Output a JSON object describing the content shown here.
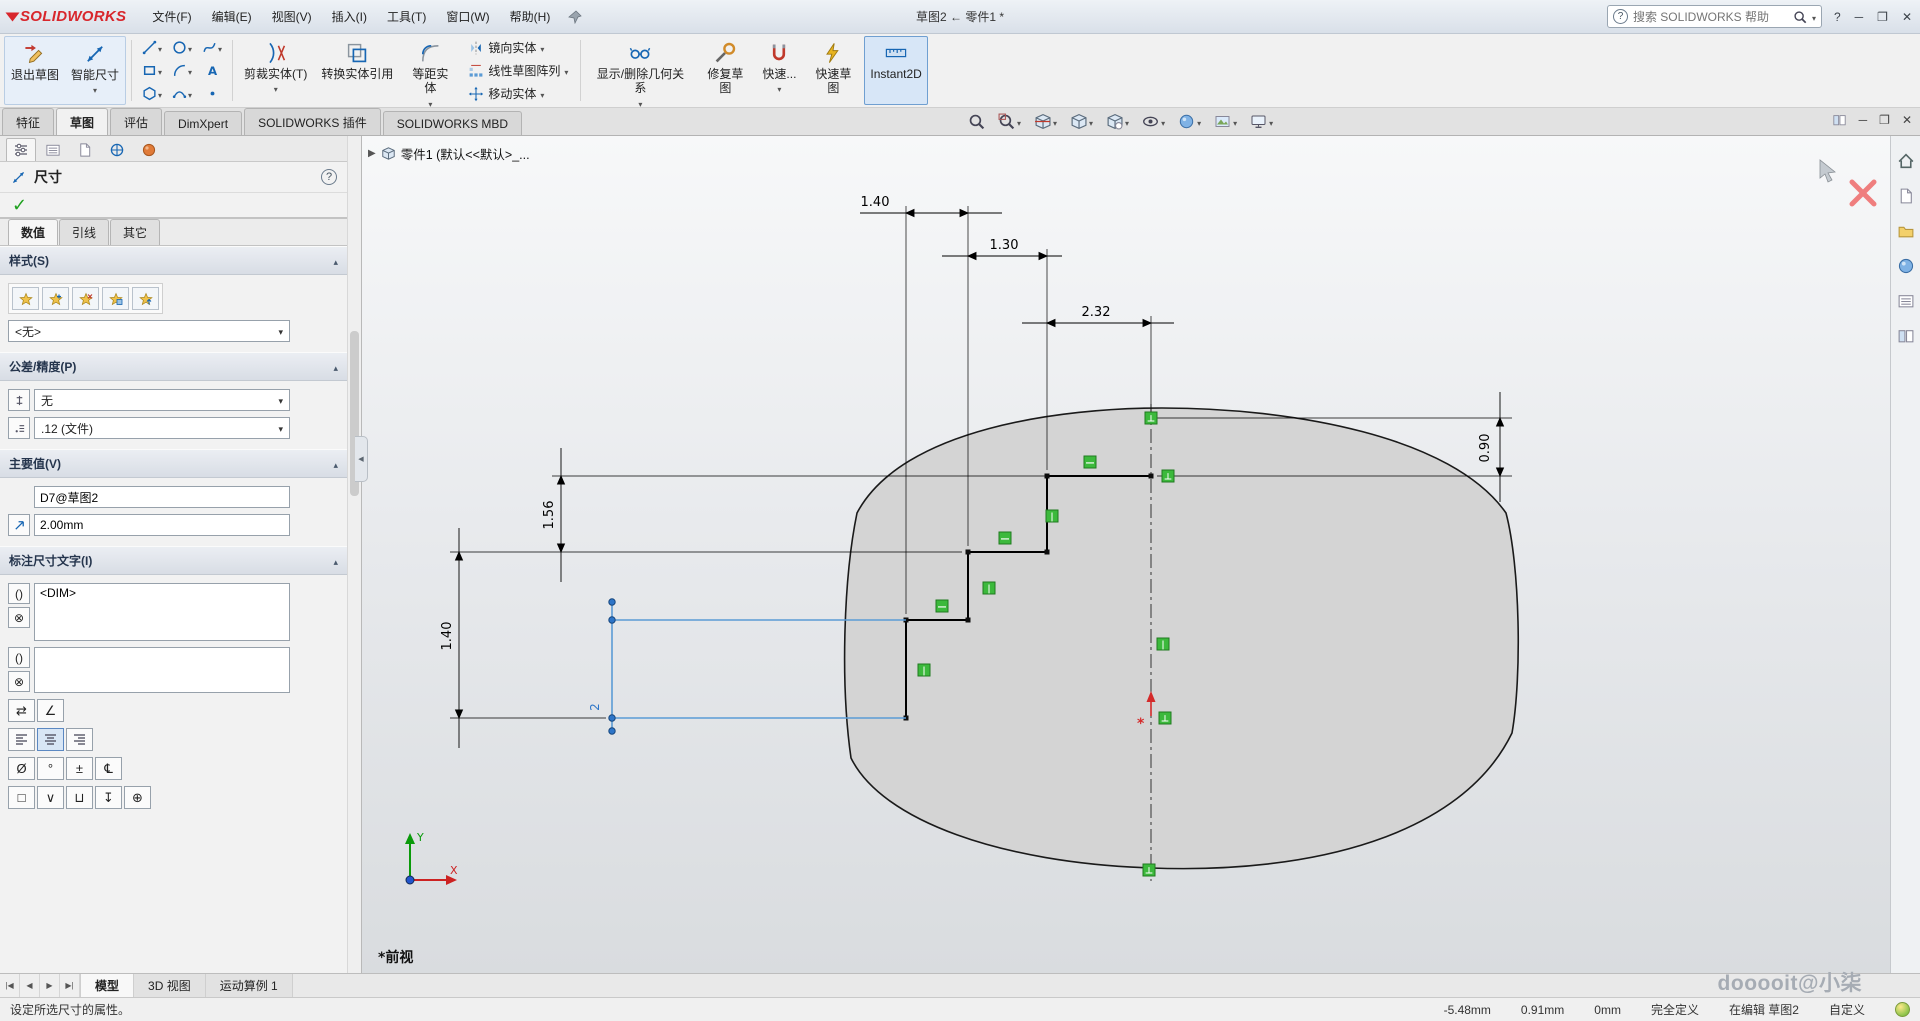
{
  "icons": {
    "caret_down": "▾",
    "section_collapse": "▴",
    "panel_collapse": "◀",
    "check": "✓",
    "vcr_first": "|◀",
    "vcr_prev": "◀",
    "vcr_next": "▶",
    "vcr_last": "▶|"
  },
  "titlebar": {
    "logo": "SOLIDWORKS",
    "menus": [
      "文件(F)",
      "编辑(E)",
      "视图(V)",
      "插入(I)",
      "工具(T)",
      "窗口(W)",
      "帮助(H)"
    ],
    "doc_title": "草图2 ← 零件1 *",
    "search_placeholder": "搜索 SOLIDWORKS 帮助",
    "controls": {
      "help": "?",
      "minimize": "─",
      "restore": "❐",
      "close": "✕"
    }
  },
  "ribbon": {
    "exit_sketch": "退出草图",
    "smart_dimension": "智能尺寸",
    "trim_entities": "剪裁实体(T)",
    "convert_entities": "转换实体引用",
    "offset_entities": "等距实体",
    "mirror_entities": "镜向实体",
    "linear_pattern": "线性草图阵列",
    "move_entities": "移动实体",
    "display_relations": "显示/删除几何关系",
    "repair_sketch": "修复草图",
    "quick_snaps": "快速...",
    "rapid_sketch": "快速草图",
    "instant2d": "Instant2D"
  },
  "mode_tabs": [
    "特征",
    "草图",
    "评估",
    "DimXpert",
    "SOLIDWORKS 插件",
    "SOLIDWORKS MBD"
  ],
  "pm": {
    "title": "尺寸",
    "help": "?",
    "value_tabs": [
      "数值",
      "引线",
      "其它"
    ],
    "style_header": "样式(S)",
    "style_none": "<无>",
    "tol_header": "公差/精度(P)",
    "tol_type": "无",
    "tol_precision": ".12 (文件)",
    "primary_header": "主要值(V)",
    "dim_name": "D7@草图2",
    "dim_value": "2.00mm",
    "dimtext_header": "标注尺寸文字(I)",
    "dim_text": "<DIM>",
    "txt_btns": [
      "()",
      "⊗"
    ],
    "arrow_btns": [
      "⇄",
      "∠"
    ],
    "symbols": [
      "Ø",
      "°",
      "±",
      "℄"
    ],
    "symbols2": [
      "□",
      "∨",
      "⊔",
      "↧",
      "⊕"
    ]
  },
  "sketch": {
    "tree_label": "零件1 (默认<<默认>_...",
    "view_label": "*前视",
    "axis_x": "X",
    "axis_y": "Y",
    "dims": {
      "top1": "1.40",
      "top2": "1.30",
      "top3": "2.32",
      "left1": "1.56",
      "left2": "1.40",
      "right1": "0.90",
      "blue": "2"
    },
    "constraints": [
      "⊥",
      "⊥",
      "—",
      "|",
      "—",
      "|",
      "—",
      "|",
      "|",
      "⊥",
      "⊥"
    ]
  },
  "bottombar": {
    "tabs": [
      "模型",
      "3D 视图",
      "运动算例 1"
    ]
  },
  "watermark": "dooooit@小柒",
  "statusbar": {
    "hint": "设定所选尺寸的属性。",
    "x": "-5.48mm",
    "y": "0.91mm",
    "z": "0mm",
    "state": "完全定义",
    "editing": "在编辑 草图2",
    "custom": "自定义"
  },
  "colors": {
    "logo_red": "#d8262c",
    "selection_blue": "#5b9bd5",
    "constraint_green": "#3cb93c",
    "accent": "#2e75c8"
  }
}
